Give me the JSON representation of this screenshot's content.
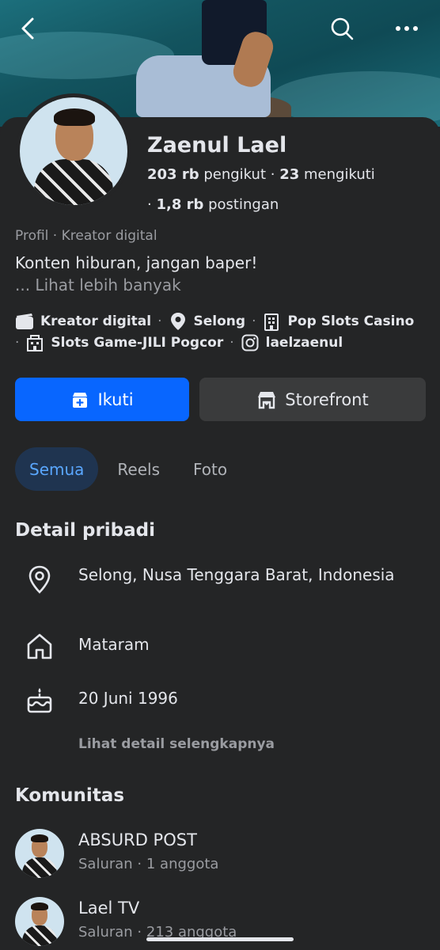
{
  "profile": {
    "name": "Zaenul Lael",
    "followers_count": "203 rb",
    "followers_label": "pengikut",
    "following_count": "23",
    "following_label": "mengikuti",
    "posts_count": "1,8 rb",
    "posts_label": "postingan",
    "category_line": "Profil · Kreator digital",
    "bio": "Konten hiburan, jangan baper!",
    "see_more": "... Lihat lebih banyak"
  },
  "meta": {
    "creator": "Kreator digital",
    "location": "Selong",
    "page1": "Pop Slots Casino",
    "page2": "Slots Game-JILI Pogcor",
    "instagram": "laelzaenul"
  },
  "actions": {
    "follow_label": "Ikuti",
    "storefront_label": "Storefront"
  },
  "tabs": [
    {
      "label": "Semua",
      "active": true
    },
    {
      "label": "Reels",
      "active": false
    },
    {
      "label": "Foto",
      "active": false
    }
  ],
  "details": {
    "title": "Detail pribadi",
    "location": "Selong, Nusa Tenggara Barat, Indonesia",
    "hometown": "Mataram",
    "birthday": "20 Juni 1996",
    "see_all": "Lihat detail selengkapnya"
  },
  "communities": {
    "title": "Komunitas",
    "items": [
      {
        "name": "ABSURD POST",
        "sub": "Saluran · 1 anggota"
      },
      {
        "name": "Lael TV",
        "sub": "Saluran · 213 anggota"
      }
    ]
  },
  "colors": {
    "accent": "#0866ff",
    "background": "#242526",
    "tab_active_bg": "#1f3450"
  }
}
